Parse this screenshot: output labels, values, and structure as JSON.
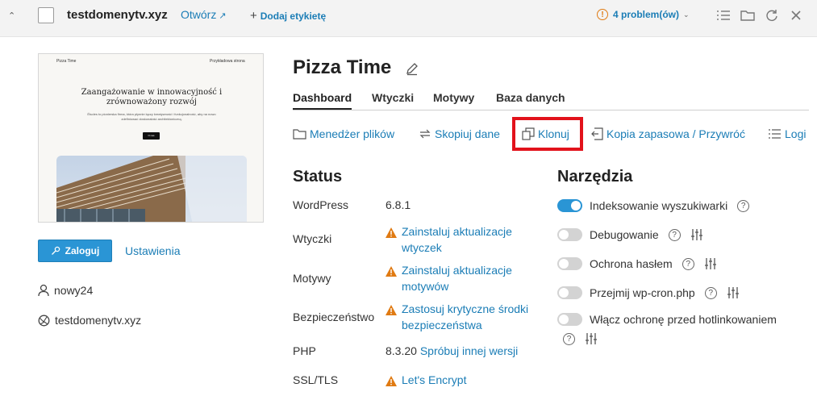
{
  "topbar": {
    "collapse_icon": "chevron-up-icon",
    "domain": "testdomenytv.xyz",
    "open_label": "Otwórz",
    "add_tag_label": "Dodaj etykietę",
    "problems_label": "4 problem(ów)"
  },
  "preview": {
    "site_name": "Pizza Time",
    "nav_label": "Przykładowa strona",
    "heading": "Zaangażowanie w innowacyjność i zrównoważony rozwój",
    "body": "Études to pionierska firma, która płynnie łączy kreatywność i funkcjonalność, aby na nowo zdefiniować doskonałość architektoniczną.",
    "button": "O nas"
  },
  "left": {
    "login_label": "Zaloguj",
    "settings_label": "Ustawienia",
    "user": "nowy24",
    "domain": "testdomenytv.xyz"
  },
  "site": {
    "title": "Pizza Time",
    "tabs": [
      "Dashboard",
      "Wtyczki",
      "Motywy",
      "Baza danych"
    ],
    "active_tab": "Dashboard"
  },
  "actions": {
    "file_manager": "Menedżer plików",
    "copy_data": "Skopiuj dane",
    "clone": "Klonuj",
    "backup": "Kopia zapasowa / Przywróć",
    "logs": "Logi"
  },
  "status": {
    "title": "Status",
    "wordpress_label": "WordPress",
    "wordpress_value": "6.8.1",
    "plugins_label": "Wtyczki",
    "plugins_value": "Zainstaluj aktualizacje wtyczek",
    "themes_label": "Motywy",
    "themes_value": "Zainstaluj aktualizacje motywów",
    "security_label": "Bezpieczeństwo",
    "security_value": "Zastosuj krytyczne środki bezpieczeństwa",
    "php_label": "PHP",
    "php_value": "8.3.20",
    "php_link": "Spróbuj innej wersji",
    "ssl_label": "SSL/TLS",
    "ssl_value": "Let's Encrypt"
  },
  "tools": {
    "title": "Narzędzia",
    "items": [
      {
        "label": "Indeksowanie wyszukiwarki",
        "on": true
      },
      {
        "label": "Debugowanie",
        "on": false
      },
      {
        "label": "Ochrona hasłem",
        "on": false
      },
      {
        "label": "Przejmij wp-cron.php",
        "on": false
      },
      {
        "label": "Włącz ochronę przed hotlinkowaniem",
        "on": false
      }
    ]
  },
  "colors": {
    "accent": "#2a95d5",
    "link": "#1b7db6",
    "warning": "#e07a12",
    "highlight": "#e2121b"
  }
}
